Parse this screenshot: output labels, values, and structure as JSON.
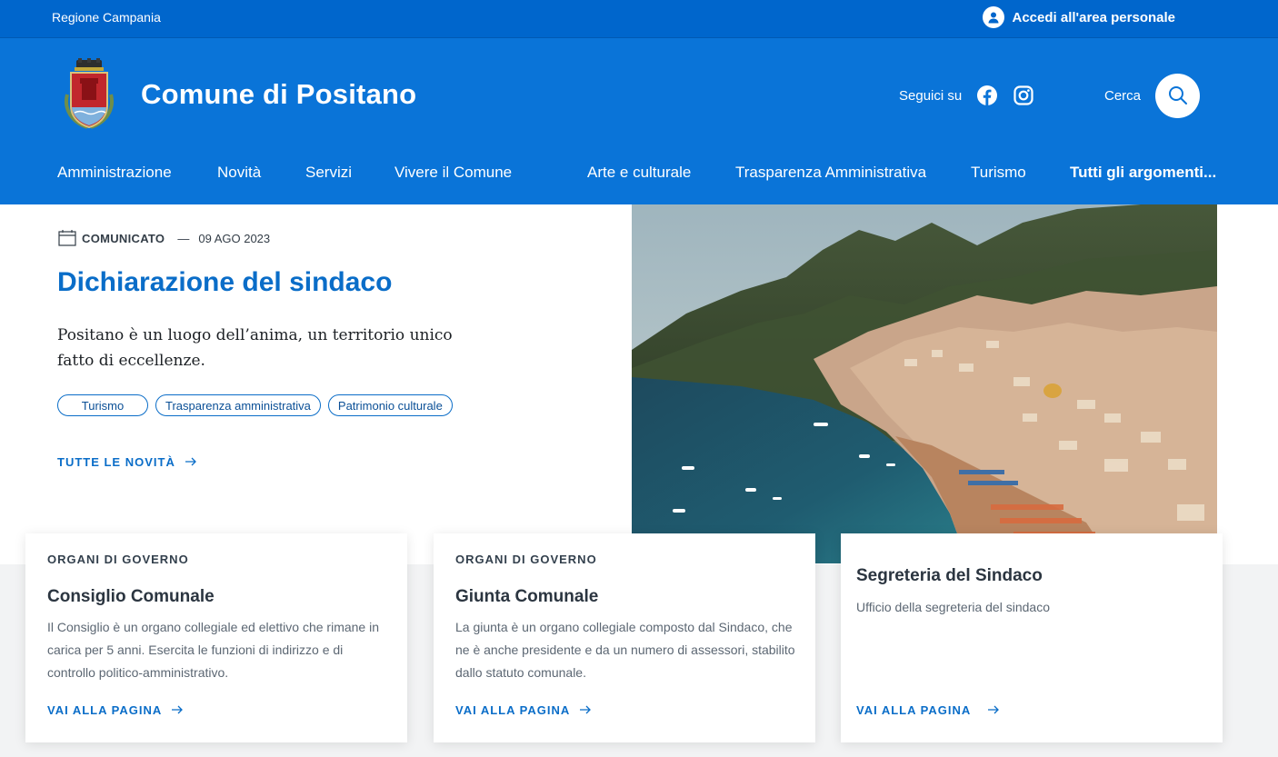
{
  "slim_header": {
    "region_label": "Regione Campania",
    "login_label": "Accedi all'area personale"
  },
  "header": {
    "site_title": "Comune di Positano",
    "social_label": "Seguici su",
    "social_icons": [
      "facebook-icon",
      "instagram-icon"
    ],
    "search_label": "Cerca"
  },
  "nav": {
    "items": [
      "Amministrazione",
      "Novità",
      "Servizi",
      "Vivere il Comune",
      "Arte e culturale",
      "Trasparenza Amministrativa",
      "Turismo"
    ],
    "all_topics": "Tutti gli argomenti..."
  },
  "hero": {
    "category": "COMUNICATO",
    "separator": "—",
    "date": "09 AGO 2023",
    "title": "Dichiarazione del sindaco",
    "lead": "Positano è un luogo dell’anima, un territorio unico fatto di eccellenze.",
    "tags": [
      "Turismo",
      "Trasparenza amministrativa",
      "Patrimonio culturale"
    ],
    "all_news_label": "TUTTE LE NOVITÀ"
  },
  "cards": [
    {
      "kicker": "ORGANI DI GOVERNO",
      "title": "Consiglio Comunale",
      "text": "Il Consiglio è un organo collegiale ed elettivo che rimane in carica per 5 anni. Esercita le funzioni di indirizzo e di controllo politico-amministrativo.",
      "link": "VAI ALLA PAGINA"
    },
    {
      "kicker": "ORGANI DI GOVERNO",
      "title": "Giunta Comunale",
      "text": "La giunta è un organo collegiale composto dal Sindaco, che ne è anche presidente e da un numero di assessori, stabilito dallo statuto comunale.",
      "link": "VAI ALLA PAGINA"
    },
    {
      "title": "Segreteria del Sindaco",
      "text": "Ufficio della segreteria del sindaco",
      "link": "VAI ALLA PAGINA"
    }
  ],
  "colors": {
    "slim_bg": "#0066cc",
    "header_bg": "#0a74d8",
    "accent": "#0a6dc8",
    "band_bg": "#f2f3f4"
  }
}
